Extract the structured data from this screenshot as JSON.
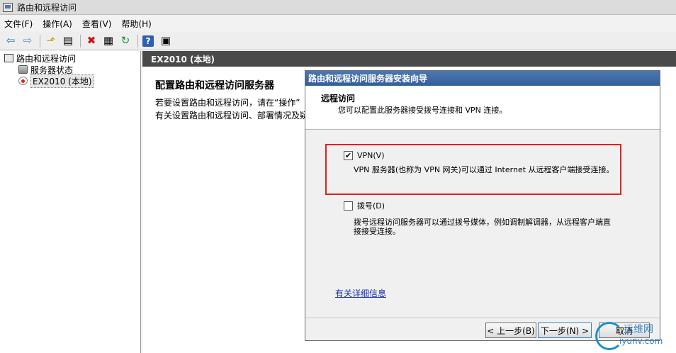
{
  "window": {
    "title": "路由和远程访问"
  },
  "menu": [
    "文件(F)",
    "操作(A)",
    "查看(V)",
    "帮助(H)"
  ],
  "toolbar": {
    "icons": [
      "back-arrow-icon",
      "forward-arrow-icon",
      "up-folder-icon",
      "show-hide-tree-icon",
      "delete-icon",
      "properties-icon",
      "refresh-icon",
      "help-icon",
      "console-icon"
    ],
    "glyphs": {
      "back": "⇦",
      "forward": "⇨",
      "up": "⬏",
      "tree": "▤",
      "delete": "✖",
      "properties": "▦",
      "refresh": "↻",
      "help": "?",
      "console": "▣"
    }
  },
  "tree": {
    "root": "路由和远程访问",
    "items": [
      {
        "label": "服务器状态"
      },
      {
        "label": "EX2010 (本地)",
        "selected": true
      }
    ]
  },
  "content": {
    "header": "EX2010 (本地)",
    "title": "配置路由和远程访问服务器",
    "line1": "若要设置路由和远程访问，请在“操作”",
    "line2": "有关设置路由和远程访问、部署情况及疑"
  },
  "wizard": {
    "title": "路由和远程访问服务器安装向导",
    "heading": "远程访问",
    "subheading": "您可以配置此服务器接受拨号连接和 VPN 连接。",
    "options": [
      {
        "label": "VPN(V)",
        "checked": true,
        "mark": "✔",
        "description": "VPN 服务器(也称为 VPN 网关)可以通过 Internet 从远程客户端接受连接。"
      },
      {
        "label": "拨号(D)",
        "checked": false,
        "mark": "",
        "description": "拨号远程访问服务器可以通过拨号媒体，例如调制解调器，从远程客户端直接接受连接。"
      }
    ],
    "more_info": "有关详细信息",
    "buttons": {
      "back": "< 上一步(B)",
      "next": "下一步(N) >",
      "cancel": "取消"
    }
  },
  "watermark": {
    "cn": "运维网",
    "en": "iyunv.com"
  },
  "colors": {
    "highlight": "#e0201e",
    "wizard_title": "#3a66a2",
    "link": "#1a2fa8",
    "header_bar": "#4a4a4a"
  }
}
